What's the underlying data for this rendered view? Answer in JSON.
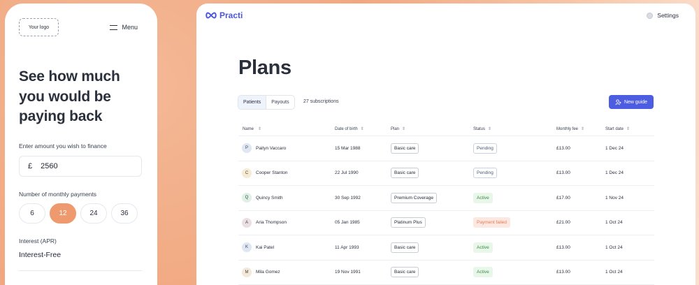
{
  "phone": {
    "logo": "Your logo",
    "menu_label": "Menu",
    "headline_lines": [
      "See how much",
      "you would be",
      "paying back"
    ],
    "amount_label": "Enter amount you wish to finance",
    "currency": "£",
    "amount_value": "2560",
    "payments_label": "Number of monthly payments",
    "payment_options": [
      "6",
      "12",
      "24",
      "36"
    ],
    "selected_payment": "12",
    "apr_label": "Interest (APR)",
    "apr_value": "Interest-Free"
  },
  "browser": {
    "brand": "Practi",
    "settings_label": "Settings",
    "page_title": "Plans",
    "tabs": [
      "Patients",
      "Payouts"
    ],
    "active_tab": "Patients",
    "subscription_count": "27 subscriptions",
    "new_guide_label": "New guide",
    "table": {
      "columns": [
        "Name",
        "Date of birth",
        "Plan",
        "Status",
        "Monthly fee",
        "Start date"
      ],
      "rows": [
        {
          "initial": "P",
          "name": "Paityn Vaccaro",
          "dob": "15 Mar 1988",
          "plan": "Basic care",
          "status": "Pending",
          "fee": "£13.00",
          "start": "1 Dec 24",
          "avatar_color": "#dfe7f2"
        },
        {
          "initial": "C",
          "name": "Cooper Stanton",
          "dob": "22 Jul 1990",
          "plan": "Basic care",
          "status": "Pending",
          "fee": "£13.00",
          "start": "1 Dec 24",
          "avatar_color": "#f6ecd4"
        },
        {
          "initial": "Q",
          "name": "Quincy Smith",
          "dob": "30 Sep 1992",
          "plan": "Premium Coverage",
          "status": "Active",
          "fee": "£17.00",
          "start": "1 Nov 24",
          "avatar_color": "#dff0e4"
        },
        {
          "initial": "A",
          "name": "Aria Thompson",
          "dob": "05 Jan 1985",
          "plan": "Platinum Plus",
          "status": "Payment failed",
          "fee": "£21.00",
          "start": "1 Oct 24",
          "avatar_color": "#ecdfe4"
        },
        {
          "initial": "K",
          "name": "Kai Patel",
          "dob": "11 Apr 1993",
          "plan": "Basic care",
          "status": "Active",
          "fee": "£13.00",
          "start": "1 Oct 24",
          "avatar_color": "#dfe7f2"
        },
        {
          "initial": "M",
          "name": "Mila Gomez",
          "dob": "19 Nov 1991",
          "plan": "Basic care",
          "status": "Active",
          "fee": "£13.00",
          "start": "1 Oct 24",
          "avatar_color": "#f3e9d8"
        }
      ]
    }
  },
  "colors": {
    "accent": "#ee9a6e",
    "brand": "#4a57dc",
    "button": "#4c5de2",
    "status_pending": "#4c5b77",
    "status_active": "#3b8b45",
    "status_failed": "#e07a5a"
  }
}
